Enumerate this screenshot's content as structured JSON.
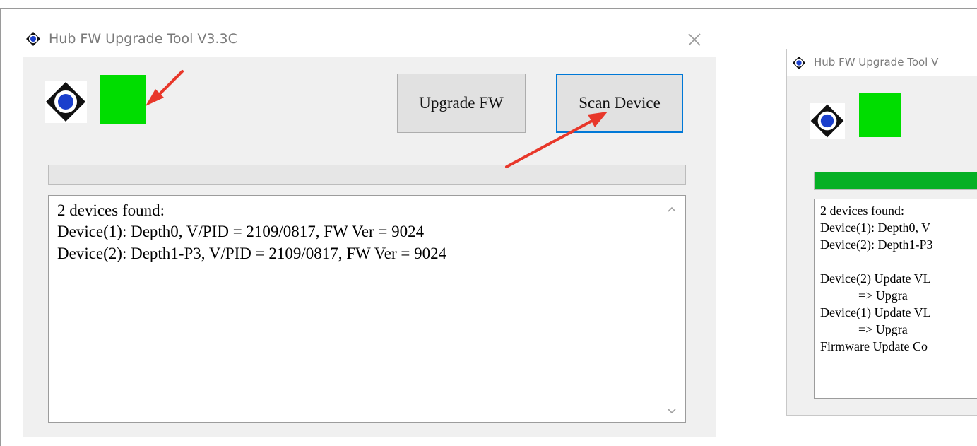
{
  "left_window": {
    "title": "Hub FW Upgrade Tool V3.3C",
    "upgrade_button": "Upgrade FW",
    "scan_button": "Scan Device",
    "status_color": "#00dd00",
    "progress_percent": 0,
    "log_lines": [
      "2 devices found:",
      "Device(1): Depth0, V/PID = 2109/0817, FW Ver = 9024",
      "Device(2): Depth1-P3, V/PID = 2109/0817, FW Ver = 9024"
    ]
  },
  "right_window": {
    "title": "Hub FW Upgrade Tool V",
    "status_color": "#00dd00",
    "progress_percent": 100,
    "progress_color": "#06b025",
    "log_lines": [
      "2 devices found:",
      "Device(1): Depth0, V",
      "Device(2): Depth1-P3",
      "",
      "Device(2) Update VL",
      "            => Upgra",
      "Device(1) Update VL",
      "            => Upgra",
      "Firmware Update Co"
    ]
  },
  "annotation": {
    "arrow_color": "#e8372a"
  }
}
